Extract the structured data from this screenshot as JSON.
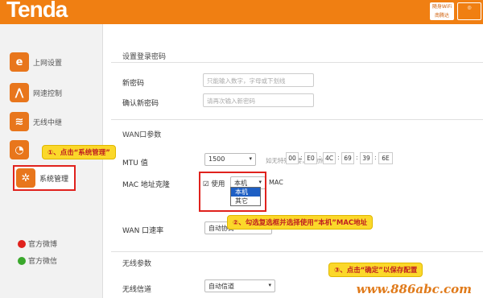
{
  "header": {
    "logo": "Tenda",
    "badge_1": "随身WiFi\n南腾达"
  },
  "sidebar": {
    "items": [
      {
        "label": "上网设置",
        "icon": "e",
        "color": "#e8761c"
      },
      {
        "label": "网速控制",
        "icon": "~",
        "color": "#e8761c"
      },
      {
        "label": "无线中继",
        "icon": "≋",
        "color": "#e8761c"
      },
      {
        "label": "",
        "icon": "◔",
        "color": "#e8761c"
      },
      {
        "label": "系统管理",
        "icon": "✲",
        "color": "#e8761c"
      }
    ],
    "weibo": "官方微博",
    "wechat": "官方微信"
  },
  "login_section": {
    "title": "设置登录密码",
    "new_password_label": "新密码",
    "new_password_placeholder": "只能输入数字，字母或下划线",
    "confirm_label": "确认新密码",
    "confirm_placeholder": "请再次输入新密码"
  },
  "wan_section": {
    "title": "WAN口参数",
    "mtu_label": "MTU 值",
    "mtu_value": "1500",
    "mtu_hint": "如无特殊需要，请勿修改",
    "mac_label": "MAC 地址克隆",
    "use_label": "使用",
    "mac_select": "本机",
    "mac_prefix": "MAC",
    "mac": [
      "00",
      "E0",
      "4C",
      "69",
      "39",
      "6E"
    ],
    "dropdown_options": [
      "本机",
      "其它"
    ],
    "speed_label": "WAN 口速率",
    "speed_value": "自动协商"
  },
  "wireless_section": {
    "title": "无线参数",
    "channel_label": "无线信道",
    "channel_value": "自动信道"
  },
  "annotations": {
    "step1": "①、点击“系统管理”",
    "step2": "②、勾选复选框并选择使用“本机”MAC地址",
    "step3": "③、点击“确定”以保存配置"
  },
  "watermark": "www.886abc.com"
}
